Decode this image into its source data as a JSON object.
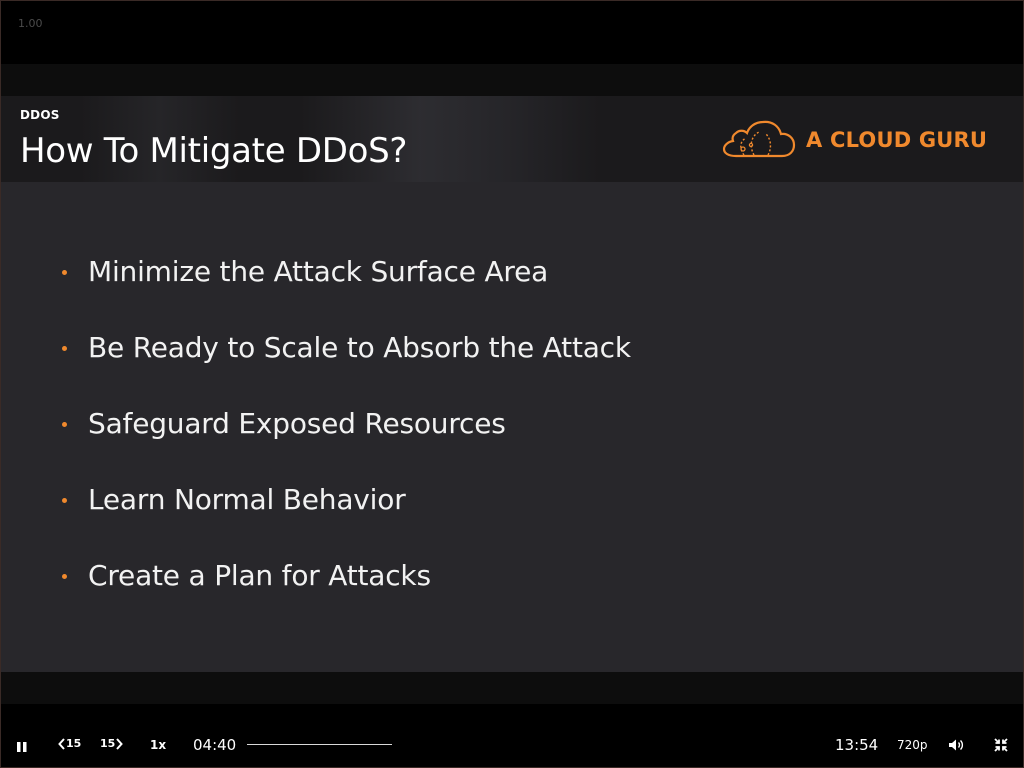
{
  "overlay": {
    "zoom_level": "1.00"
  },
  "slide": {
    "section": "DDOS",
    "title": "How To Mitigate DDoS?",
    "logo_text": "A CLOUD GURU",
    "bullets": [
      "Minimize the Attack Surface Area",
      "Be Ready to Scale to Absorb the Attack",
      "Safeguard Exposed Resources",
      "Learn Normal Behavior",
      "Create a Plan for Attacks"
    ]
  },
  "player": {
    "play_state_icon": "pause-icon",
    "rewind_label": "15",
    "forward_label": "15",
    "speed": "1x",
    "current_time": "04:40",
    "duration": "13:54",
    "quality": "720p",
    "volume_icon": "volume-icon",
    "exit_fullscreen_icon": "exit-fullscreen-icon"
  },
  "colors": {
    "accent": "#f0892d",
    "slide_bg": "#28272b",
    "header_bg": "#1b1a1c"
  }
}
